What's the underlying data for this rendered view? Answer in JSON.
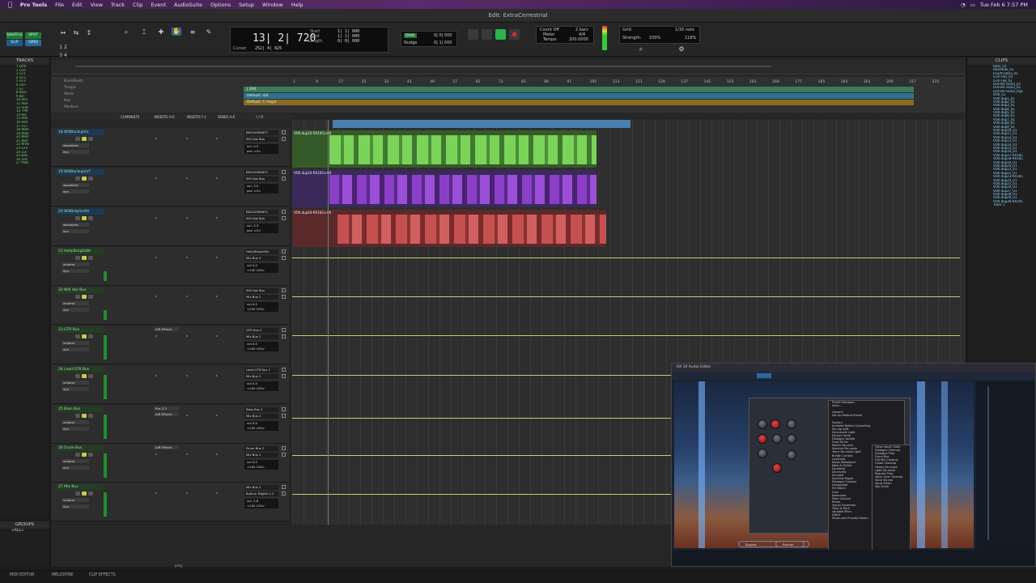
{
  "menubar": {
    "apple": "",
    "items": [
      "Pro Tools",
      "File",
      "Edit",
      "View",
      "Track",
      "Clip",
      "Event",
      "AudioSuite",
      "Options",
      "Setup",
      "Window",
      "Help"
    ],
    "clock": "Tue Feb 6 7:57 PM"
  },
  "window": {
    "title": "Edit: ExtraCerrestrial"
  },
  "toolbar": {
    "modes": [
      "SHUFFLE",
      "SPOT",
      "SLIP",
      "GRID"
    ],
    "counter_main": "13| 2| 720",
    "start_label": "Start",
    "start_val": "1| 1| 000",
    "end_label": "End",
    "end_val": "1| 1| 000",
    "length_label": "Length",
    "length_val": "0| 0| 000",
    "cursor_label": "Cursor",
    "cursor_val": "252| 4| 825",
    "nudge_label": "Nudge",
    "nudge_val": "0| 1| 000",
    "pre_val": "0| 0| 000",
    "count_off": "Count Off",
    "meter_label": "Meter",
    "meter_val": "4/4",
    "tempo_label": "Tempo",
    "tempo_val": "200.0000",
    "bars_val": "2 bars",
    "grid_label": "Grid:",
    "grid_val": "1/16 note",
    "strength_label": "Strength:",
    "strength_val": "100%",
    "zoom_val": "118%"
  },
  "tracks_panel": {
    "title": "TRACKS",
    "items": [
      "1 Drm",
      "2 GTR",
      "3 GT1",
      "4 GT2",
      "5 GT3",
      "6 OUT",
      "7 GT",
      "8 Bass",
      "9 Bsl",
      "10 Bsl1",
      "11 RBX",
      "12 SUB",
      "13 THR",
      "14 HD",
      "15 HBV",
      "16 HBV",
      "17 V17",
      "18 WBV",
      "19 WBV",
      "20 WBV",
      "21 HBV",
      "22 WVB",
      "23 GTR",
      "24 LGT",
      "25 BsB",
      "26 DrB",
      "27 MxB"
    ]
  },
  "groups_panel": {
    "title": "GROUPS",
    "item": "<ALL>"
  },
  "rulers": {
    "labels": [
      "Bars|Beats",
      "Tempo",
      "Meter",
      "Key",
      "Markers"
    ],
    "bars": [
      "1",
      "9",
      "17",
      "25",
      "33",
      "41",
      "49",
      "57",
      "65",
      "73",
      "81",
      "89",
      "97",
      "105",
      "113",
      "121",
      "129",
      "137",
      "145",
      "153",
      "161",
      "169",
      "177",
      "185",
      "193",
      "201",
      "209",
      "217",
      "225"
    ],
    "tempo_text": "J 200",
    "meter_text": "Default: 4/4",
    "key_text": "Default: C major"
  },
  "columns": [
    "COMMENTS",
    "INSERTS A-E",
    "INSERTS F-J",
    "SENDS A-E",
    "I / O"
  ],
  "tracks": [
    {
      "name": "18 WillBackupVx",
      "io1": "BKGLVMDINT1",
      "io2": "Will Vox Bus",
      "vol": "vol  -0.5",
      "pan": "pan  >0<",
      "sub1": "waveform",
      "sub2": "dyn",
      "clip": "VOX.dup10-RX10Co-00"
    },
    {
      "name": "19 WillBackupVxT",
      "io1": "BKGLVMDINT1",
      "io2": "Will Vox Bus",
      "vol": "vol  -3.5",
      "pan": "pan  >0<",
      "sub1": "waveform",
      "sub2": "dyn",
      "clip": "VOX.dup10-RX10Co-00"
    },
    {
      "name": "20 WillBckpVxAlt",
      "io1": "BKGLVMDINT1",
      "io2": "Will Vox Bus",
      "vol": "vol  -3.3",
      "pan": "pan  >0<",
      "sub1": "waveform",
      "sub2": "dyn",
      "clip": "VOX.dup20-RX10Co-00"
    },
    {
      "name": "21 HollyBckgVoBs",
      "io1": "HollyBckgndVx",
      "io2": "Mix Bus 2",
      "vol": "vol  0.0",
      "pan": "<100  100>",
      "sub1": "volume",
      "sub2": "dyn"
    },
    {
      "name": "22 Will Vox Bus",
      "io1": "Will Vox Bus",
      "io2": "Mix Bus 2",
      "vol": "vol  0.0",
      "pan": "<100  100>",
      "sub1": "volume",
      "sub2": "dyn"
    },
    {
      "name": "23  GTR Bus",
      "io1": "GTR Bus 2",
      "io2": "Mix Bus 2",
      "vol": "vol  0.0",
      "pan": "<100  100>",
      "sub1": "volume",
      "sub2": "dyn",
      "insert": "AIR Effects"
    },
    {
      "name": "24 Lead GTR Bus",
      "io1": "Lead GTR Bus 1",
      "io2": "Mix Bus 2",
      "vol": "vol  0.0",
      "pan": "<100  100>",
      "sub1": "volume",
      "sub2": "dyn"
    },
    {
      "name": "25  Bass Bus",
      "io1": "Bass Bus 1",
      "io2": "Mix Bus 2",
      "vol": "vol  0.0",
      "pan": "<100  100>",
      "sub1": "volume",
      "sub2": "dyn",
      "insert": "Pro-Q 3",
      "insert2": "AIR Effects"
    },
    {
      "name": "26  Drum Bus",
      "io1": "Drum Bus 2",
      "io2": "Mix Bus 2",
      "vol": "vol  0.0",
      "pan": "<100  100>",
      "sub1": "volume",
      "sub2": "dyn",
      "insert": "AIR Effects"
    },
    {
      "name": "27  Mix Bus",
      "io1": "Mix Bus 2",
      "io2": "Built-in Digital 1-2",
      "vol": "vol  -2.8",
      "pan": "<100  100>",
      "sub1": "volume",
      "sub2": "dyn"
    }
  ],
  "clips_panel": {
    "title": "CLIPS",
    "items": [
      "Bass_01",
      "BassAudi_01",
      "Fourth Bass_01",
      "GTR Ons_01",
      "GTR Fxe_01",
      "GUITAR SOLO_01",
      "GUITAR SOLO_01",
      "GUITAR SOLO_dup",
      "VOX_01",
      "VOX.dup1_01",
      "VOX.dup2_01",
      "VOX.dup3_01",
      "VOX.dup4_01",
      "VOX.dup5_01",
      "VOX.dup6_01",
      "VOX.dup7_01",
      "VOX.dup8_01",
      "VOX.dup9_01",
      "VOX.dup10_01",
      "VOX.dup11_01",
      "VOX.dup12_01",
      "VOX.dup13_01",
      "VOX.dup14_01",
      "VOX.dup15_01",
      "VOX.dup16_01",
      "VOX.dup17-RX10C",
      "VOX.dup18-RX10C",
      "VOX.dup19_01",
      "VOX.dup20_01",
      "VOX.dup21_01",
      "VOX.dup22_01",
      "VOX.dup23-RX10C",
      "VOX.dup24_01",
      "VOX.dup25_01",
      "VOX.dup26_01",
      "VOX.dup27_01",
      "VOX.dup28_01",
      "VOX.dup29_01",
      "VOX.dup30-RX10C",
      "Track 1"
    ]
  },
  "bottom": {
    "tabs": [
      "MIDI EDITOR",
      "MELODYNE",
      "CLIP EFFECTS"
    ],
    "play": "play"
  },
  "rx": {
    "title": "RX 10 Audio Editor",
    "menu": [
      "Preset Manager...",
      "Save...",
      "",
      "Generic",
      "Set As Default Preset",
      "",
      "Factory",
      "Ambient Reflect Cancelling",
      "De-clip Soft",
      "De-crackle Light",
      "De-ess Harsh",
      "Dialogue Isolate",
      "Hum 60 Hz",
      "Mouth De-click",
      "Spectral De-noise",
      "Voice De-noise Light",
      "Breath Control",
      "Loudness",
      "Music Rebalance",
      "Wow & Flutter",
      "De-bleed",
      "De-reverb",
      "De-wind",
      "Spectral Repair",
      "Dialogue Contour",
      "Interpolate",
      "EQ Match",
      "Gain",
      "Normalize",
      "Pitch Contour",
      "Phase",
      "Signal Generator",
      "Time & Pitch",
      "Variable Pitch",
      "Dither",
      "Show user Presets Folder..."
    ],
    "menu2": [
      "Clean Vocal Chain",
      "Dialogue Cleanup",
      "Dialogue Prep",
      "Drum Bus",
      "Full Mix Cleanup",
      "Guitar Cleanup",
      "Heavy De-noise",
      "Light De-noise",
      "Podcast Prep",
      "Voice Over Cleanup",
      "Vocal De-ess",
      "Vocal Polish",
      "Vox Shine"
    ],
    "buttons": [
      "Bypass",
      "Render"
    ]
  },
  "colors": {
    "green": "#6fc25a",
    "purple": "#8b3fc6",
    "red": "#c4514f",
    "blue": "#4a7fb0",
    "line": "#b6d86c"
  }
}
